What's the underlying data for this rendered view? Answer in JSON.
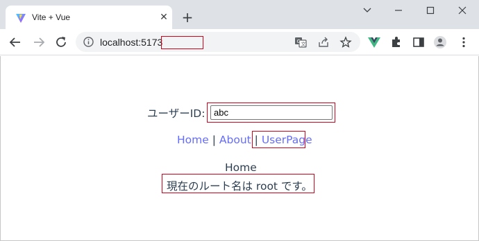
{
  "browser": {
    "tab_title": "Vite + Vue",
    "url_visible": "localhost:5173"
  },
  "page": {
    "userid_label": "ユーザーID:",
    "userid_value": "abc",
    "nav": {
      "home": "Home",
      "about": "About",
      "userpage": "UserPage",
      "separator": "|"
    },
    "view_title": "Home",
    "route_message": "現在のルート名は root です。"
  },
  "colors": {
    "link": "#646cff",
    "text": "#2c3e50",
    "highlight_box": "#d0021b"
  }
}
